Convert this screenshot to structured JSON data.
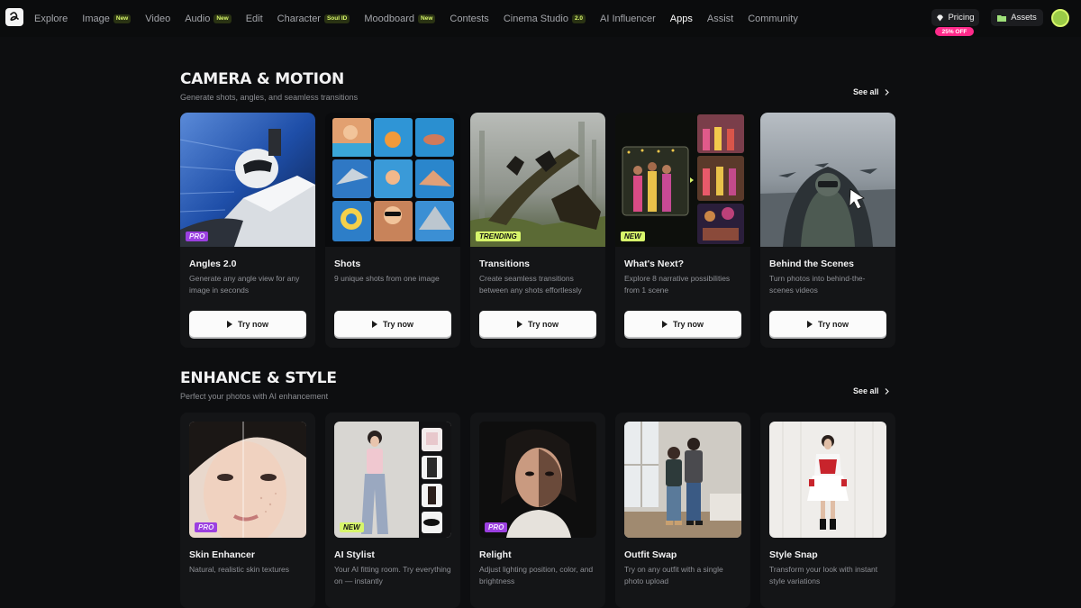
{
  "nav": {
    "items": [
      {
        "label": "Explore",
        "badge": null
      },
      {
        "label": "Image",
        "badge": "New"
      },
      {
        "label": "Video",
        "badge": null
      },
      {
        "label": "Audio",
        "badge": "New"
      },
      {
        "label": "Edit",
        "badge": null
      },
      {
        "label": "Character",
        "badge": "Soul ID"
      },
      {
        "label": "Moodboard",
        "badge": "New"
      },
      {
        "label": "Contests",
        "badge": null
      },
      {
        "label": "Cinema Studio",
        "badge": "2.0"
      },
      {
        "label": "AI Influencer",
        "badge": null
      },
      {
        "label": "Apps",
        "badge": null
      },
      {
        "label": "Assist",
        "badge": null
      },
      {
        "label": "Community",
        "badge": null
      }
    ],
    "active": "Apps",
    "pricing_label": "Pricing",
    "discount_label": "25% OFF",
    "assets_label": "Assets"
  },
  "sections": [
    {
      "title": "CAMERA & MOTION",
      "subtitle": "Generate shots, angles, and seamless transitions",
      "see_all": "See all",
      "cards": [
        {
          "title": "Angles 2.0",
          "desc": "Generate any angle view for any image in seconds",
          "tag": "PRO",
          "button": "Try now"
        },
        {
          "title": "Shots",
          "desc": "9 unique shots from one image",
          "tag": null,
          "button": "Try now"
        },
        {
          "title": "Transitions",
          "desc": "Create seamless transitions between any shots effortlessly",
          "tag": "TRENDING",
          "button": "Try now"
        },
        {
          "title": "What's Next?",
          "desc": "Explore 8 narrative possibilities from 1 scene",
          "tag": "NEW",
          "button": "Try now"
        },
        {
          "title": "Behind the Scenes",
          "desc": "Turn photos into behind-the-scenes videos",
          "tag": null,
          "button": "Try now"
        }
      ]
    },
    {
      "title": "ENHANCE & STYLE",
      "subtitle": "Perfect your photos with AI enhancement",
      "see_all": "See all",
      "cards": [
        {
          "title": "Skin Enhancer",
          "desc": "Natural, realistic skin textures",
          "tag": "PRO"
        },
        {
          "title": "AI Stylist",
          "desc": "Your AI fitting room. Try everything on — instantly",
          "tag": "NEW"
        },
        {
          "title": "Relight",
          "desc": "Adjust lighting position, color, and brightness",
          "tag": "PRO"
        },
        {
          "title": "Outfit Swap",
          "desc": "Try on any outfit with a single photo upload",
          "tag": null
        },
        {
          "title": "Style Snap",
          "desc": "Transform your look with instant style variations",
          "tag": null
        }
      ]
    }
  ],
  "colors": {
    "background": "#0d0e10",
    "card": "#141517",
    "accent_lime": "#d7f56b",
    "pro_purple": "#9b3fe0",
    "discount_pink": "#ff2a8a"
  }
}
